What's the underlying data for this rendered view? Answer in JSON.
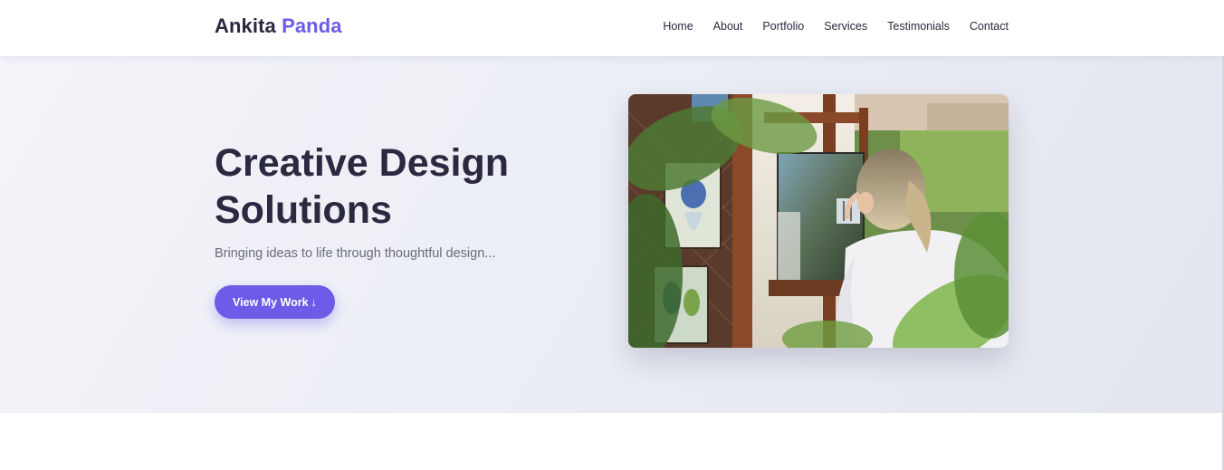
{
  "header": {
    "logo_first": "Ankita",
    "logo_second": "Panda",
    "nav": [
      {
        "label": "Home"
      },
      {
        "label": "About"
      },
      {
        "label": "Portfolio"
      },
      {
        "label": "Services"
      },
      {
        "label": "Testimonials"
      },
      {
        "label": "Contact"
      }
    ]
  },
  "hero": {
    "title": "Creative Design Solutions",
    "subtitle": "Bringing ideas to life through thoughtful design...",
    "cta_label": "View My Work",
    "cta_icon": "arrow-down-icon",
    "image_subject": "artist-painting-on-easel"
  },
  "colors": {
    "accent": "#6c5ce7",
    "text_dark": "#2b2840",
    "text_muted": "#6b6b7b",
    "hero_bg": "#eceef5"
  }
}
